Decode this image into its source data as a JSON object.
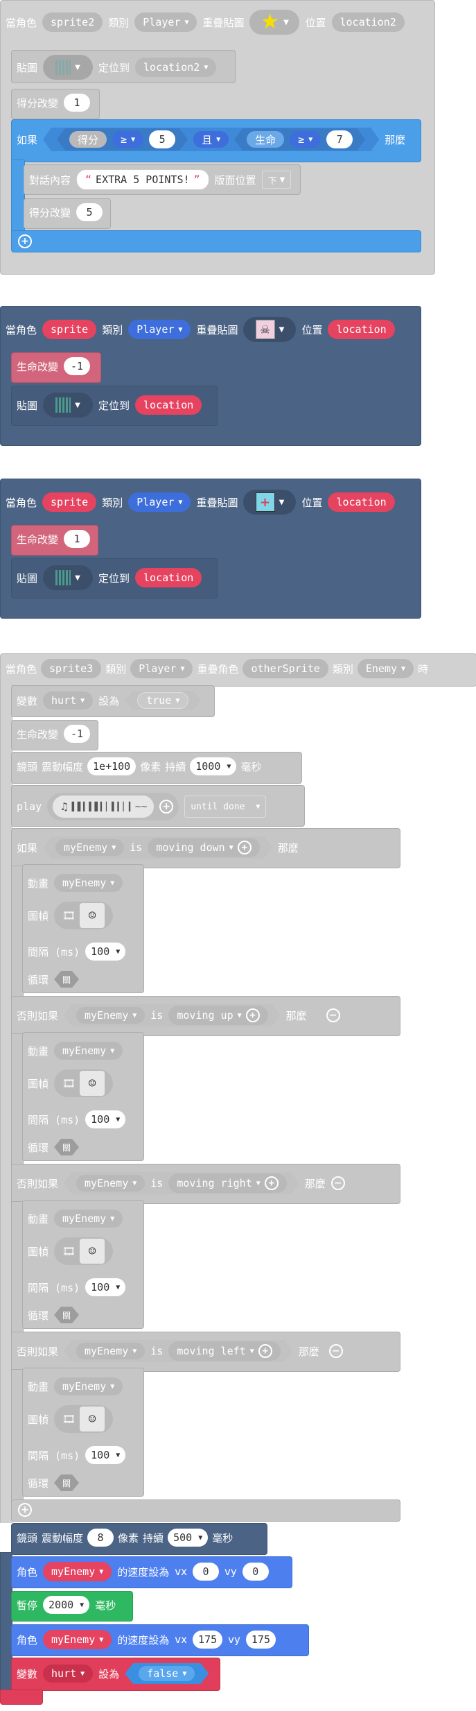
{
  "b1": {
    "when": "當角色",
    "sprite": "sprite2",
    "kind_label": "類別",
    "kind": "Player",
    "overlap": "重疊貼圖",
    "pos_label": "位置",
    "pos": "location2",
    "tile_label": "貼圖",
    "goto_label": "定位到",
    "goto": "location2",
    "score_change": "得分改變",
    "score_val": "1",
    "if": "如果",
    "score": "得分",
    "op1": "≥",
    "v1": "5",
    "and": "且",
    "life": "生命",
    "op2": "≥",
    "v2": "7",
    "then": "那麼",
    "say_label": "對話內容",
    "say": "EXTRA 5 POINTS!",
    "say_pos_label": "版面位置",
    "say_pos": "下",
    "score_change2": "得分改變",
    "score_val2": "5"
  },
  "b2": {
    "when": "當角色",
    "sprite": "sprite",
    "kind_label": "類別",
    "kind": "Player",
    "overlap": "重疊貼圖",
    "pos_label": "位置",
    "pos": "location",
    "life_change": "生命改變",
    "life_val": "-1",
    "tile_label": "貼圖",
    "goto_label": "定位到",
    "goto": "location"
  },
  "b3": {
    "when": "當角色",
    "sprite": "sprite",
    "kind_label": "類別",
    "kind": "Player",
    "overlap": "重疊貼圖",
    "pos_label": "位置",
    "pos": "location",
    "life_change": "生命改變",
    "life_val": "1",
    "tile_label": "貼圖",
    "goto_label": "定位到",
    "goto": "location"
  },
  "b4": {
    "when": "當角色",
    "sprite": "sprite3",
    "kind_label": "類別",
    "kind": "Player",
    "overlap": "重疊角色",
    "other": "otherSprite",
    "kind2_label": "類別",
    "kind2": "Enemy",
    "time": "時",
    "var_label": "變數",
    "var": "hurt",
    "set": "設為",
    "true": "true",
    "life_change": "生命改變",
    "life_val": "-1",
    "cam_label": "鏡頭",
    "shake": "震動幅度",
    "amp": "1e+100",
    "px": "像素",
    "dur": "持續",
    "ms_val": "1000",
    "ms": "毫秒",
    "play": "play",
    "until": "until done",
    "if": "如果",
    "else_if": "否則如果",
    "then": "那麼",
    "enemy": "myEnemy",
    "is": "is",
    "c1": "moving down",
    "c2": "moving up",
    "c3": "moving right",
    "c4": "moving left",
    "anim": "動畫",
    "frames": "圖幀",
    "interval": "間隔 (ms)",
    "interval_val": "100",
    "loop": "循環",
    "off": "關",
    "cam2_label": "鏡頭",
    "shake2": "震動幅度",
    "amp2": "8",
    "px2": "像素",
    "dur2": "持續",
    "ms2_val": "500",
    "ms2": "毫秒",
    "sprite_label": "角色",
    "vel": "的速度設為",
    "vx": "vx",
    "vy": "vy",
    "vx1": "0",
    "vy1": "0",
    "pause": "暫停",
    "pause_val": "2000",
    "pause_ms": "毫秒",
    "vx2": "175",
    "vy2": "175",
    "var2_label": "變數",
    "var2": "hurt",
    "set2": "設為",
    "false": "false"
  }
}
